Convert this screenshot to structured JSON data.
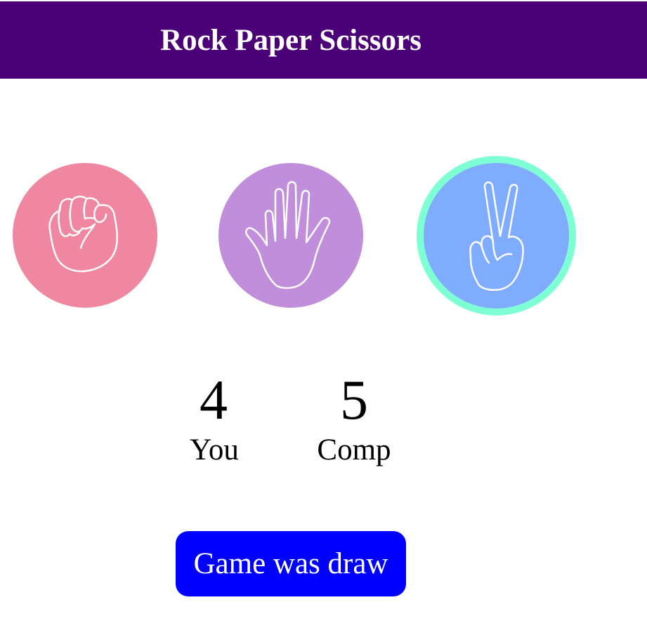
{
  "header": {
    "title": "Rock Paper Scissors",
    "background": "#4b0078"
  },
  "choices": [
    {
      "id": "rock",
      "icon": "fist-icon",
      "color": "#f087a1",
      "selected": false
    },
    {
      "id": "paper",
      "icon": "open-hand-icon",
      "color": "#c08edb",
      "selected": false
    },
    {
      "id": "scissors",
      "icon": "peace-hand-icon",
      "color": "#80acff",
      "selected": true,
      "highlight": "#7fffd4"
    }
  ],
  "score": {
    "user": {
      "value": "4",
      "label": "You"
    },
    "computer": {
      "value": "5",
      "label": "Comp"
    }
  },
  "result": {
    "message": "Game was draw",
    "background": "#0000ff"
  }
}
